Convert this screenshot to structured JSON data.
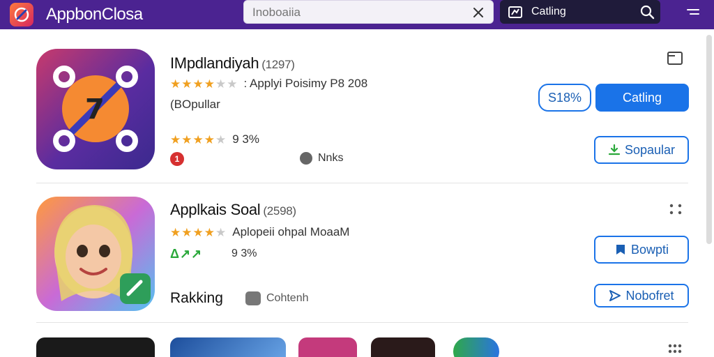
{
  "header": {
    "app_title": "AppbonClosa",
    "search_placeholder": "Inoboaiia",
    "rank_label": "Catling"
  },
  "apps": [
    {
      "name": "IMpdlandiyah",
      "count": "(1297)",
      "stars_filled": 4,
      "rating_subtitle": ": Applyi Poisimy P8 208",
      "secondary_line": "(BOpullar",
      "second_stars_filled": 4,
      "percent": "9 3%",
      "badge_number": "1",
      "author": "Nnks",
      "pct_pill": "S18%",
      "action_main": "Catling",
      "action_secondary": "Sopaular"
    },
    {
      "name": "Applkais Soal",
      "count": "(2598)",
      "stars_filled": 4,
      "rating_subtitle": "Aplopeii ohpal MoaaM",
      "percent": "9 3%",
      "ranking_label": "Rakking",
      "chip_label": "Cohtenh",
      "action_a": "Bowpti",
      "action_b": "Nobofret"
    }
  ],
  "colors": {
    "header_bg": "#4b2391",
    "accent_blue": "#1a73e8",
    "star": "#f0a020",
    "green": "#2aa83a"
  }
}
